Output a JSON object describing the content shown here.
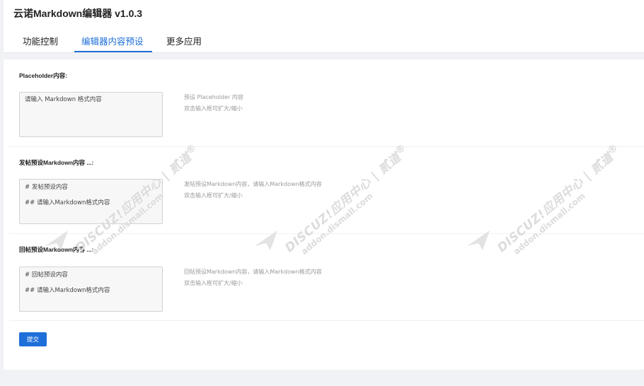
{
  "app": {
    "title": "云诺Markdown编辑器 v1.0.3"
  },
  "tabs": [
    {
      "label": "功能控制",
      "active": false
    },
    {
      "label": "编辑器内容预设",
      "active": true
    },
    {
      "label": "更多应用",
      "active": false
    }
  ],
  "form": {
    "placeholder_section": {
      "label": "Placeholder内容:",
      "value": "请输入 Markdown 格式内容",
      "hint_line1": "预设 Placeholder 内容",
      "hint_line2": "双击输入框可扩大/缩小"
    },
    "post_section": {
      "label": "发帖预设Markdown内容 ...:",
      "value": "# 发帖预设内容\n## 请输入Markdown格式内容",
      "hint_line1": "发帖预设Markdown内容，请输入Markdown格式内容",
      "hint_line2": "双击输入框可扩大/缩小"
    },
    "reply_section": {
      "label": "回帖预设Markdown内容 ...:",
      "value": "# 回帖预设内容\n## 请输入Markdown格式内容",
      "hint_line1": "回帖预设Markdown内容，请输入Markdown格式内容",
      "hint_line2": "双击输入框可扩大/缩小"
    },
    "submit_label": "提交"
  },
  "watermark": {
    "line1": "DISCUZ!应用中心 | 贰道",
    "line2": "addon.dismall.com",
    "mark": "®"
  },
  "colors": {
    "accent": "#1e6fd9",
    "watermark": "#dcdcdc"
  }
}
